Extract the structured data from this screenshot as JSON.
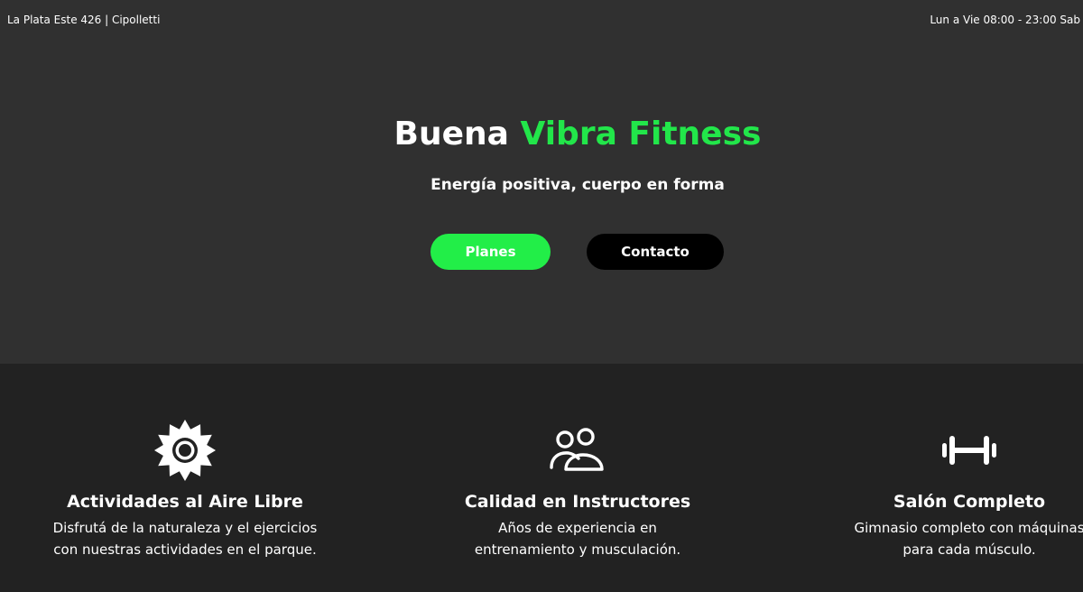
{
  "header": {
    "address": "La Plata Este 426 | Cipolletti",
    "hours": "Lun a Vie 08:00 - 23:00 Sab"
  },
  "hero": {
    "title_part1": "Buena ",
    "title_accent": "Vibra Fitness",
    "subtitle": "Energía positiva, cuerpo en forma",
    "buttons": {
      "planes": "Planes",
      "contacto": "Contacto"
    }
  },
  "features": [
    {
      "icon": "sun-icon",
      "title": "Actividades al Aire Libre",
      "desc_line1": "Disfrutá de la naturaleza y el ejercicios",
      "desc_line2": "con nuestras actividades en el parque."
    },
    {
      "icon": "users-icon",
      "title": "Calidad en Instructores",
      "desc_line1": "Años de experiencia en",
      "desc_line2": "entrenamiento y musculación."
    },
    {
      "icon": "dumbbell-icon",
      "title": "Salón Completo",
      "desc_line1": "Gimnasio completo con máquinas",
      "desc_line2": "para cada músculo."
    }
  ],
  "colors": {
    "accent": "#22e64a",
    "hero_bg": "#303030",
    "section_bg": "#222222",
    "button_dark": "#000000"
  }
}
